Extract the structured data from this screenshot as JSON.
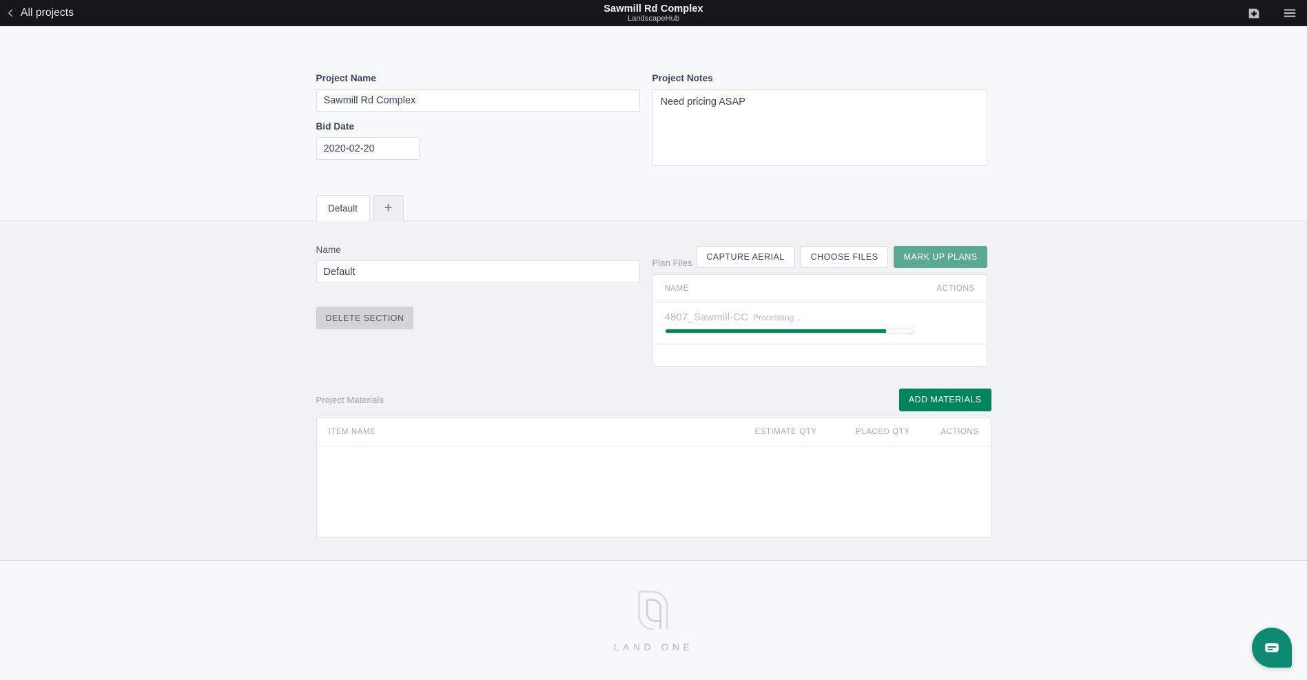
{
  "topbar": {
    "back_label": "All projects",
    "back_icon": "chevron-left-icon",
    "title": "Sawmill Rd Complex",
    "subtitle": "LandscapeHub",
    "save_icon": "save-download-icon",
    "menu_icon": "hamburger-menu-icon"
  },
  "project": {
    "name_label": "Project Name",
    "name_value": "Sawmill Rd Complex",
    "name_placeholder": "Project Name",
    "bid_date_label": "Bid Date",
    "bid_date_value": "2020-02-20",
    "notes_label": "Project Notes",
    "notes_value": "Need pricing ASAP",
    "notes_placeholder": "Project Notes"
  },
  "tabs": {
    "items": [
      {
        "label": "Default",
        "active": true
      },
      {
        "label": "+",
        "active": false
      }
    ],
    "add_label": "+"
  },
  "section": {
    "name_label": "Name",
    "name_value": "Default",
    "name_placeholder": "Name",
    "delete_label": "DELETE SECTION"
  },
  "plan_files": {
    "label": "Plan Files",
    "capture_aerial_label": "CAPTURE AERIAL",
    "choose_files_label": "CHOOSE FILES",
    "mark_up_plans_label": "MARK UP PLANS",
    "columns": {
      "name": "NAME",
      "actions": "ACTIONS"
    },
    "rows": [
      {
        "name": "4807_Sawmill-CC",
        "status": "Processing...",
        "progress_percent": 89
      }
    ]
  },
  "materials": {
    "label": "Project Materials",
    "add_label": "ADD MATERIALS",
    "columns": {
      "item_name": "ITEM NAME",
      "estimate_qty": "ESTIMATE QTY",
      "placed_qty": "PLACED QTY",
      "actions": "ACTIONS"
    },
    "rows": []
  },
  "footer": {
    "logo_text": "LAND ONE",
    "logo_mark": "land-one-monogram-icon"
  },
  "chat": {
    "icon": "chat-bubble-icon",
    "label": "Open chat"
  },
  "colors": {
    "topbar_bg": "#15171a",
    "page_bg": "#f7f8fa",
    "lower_bg": "#f1f2f4",
    "accent_sage": "#5ba893",
    "accent_green": "#00845a",
    "chat_green": "#0d8a71",
    "muted_text": "#a6abb3"
  }
}
